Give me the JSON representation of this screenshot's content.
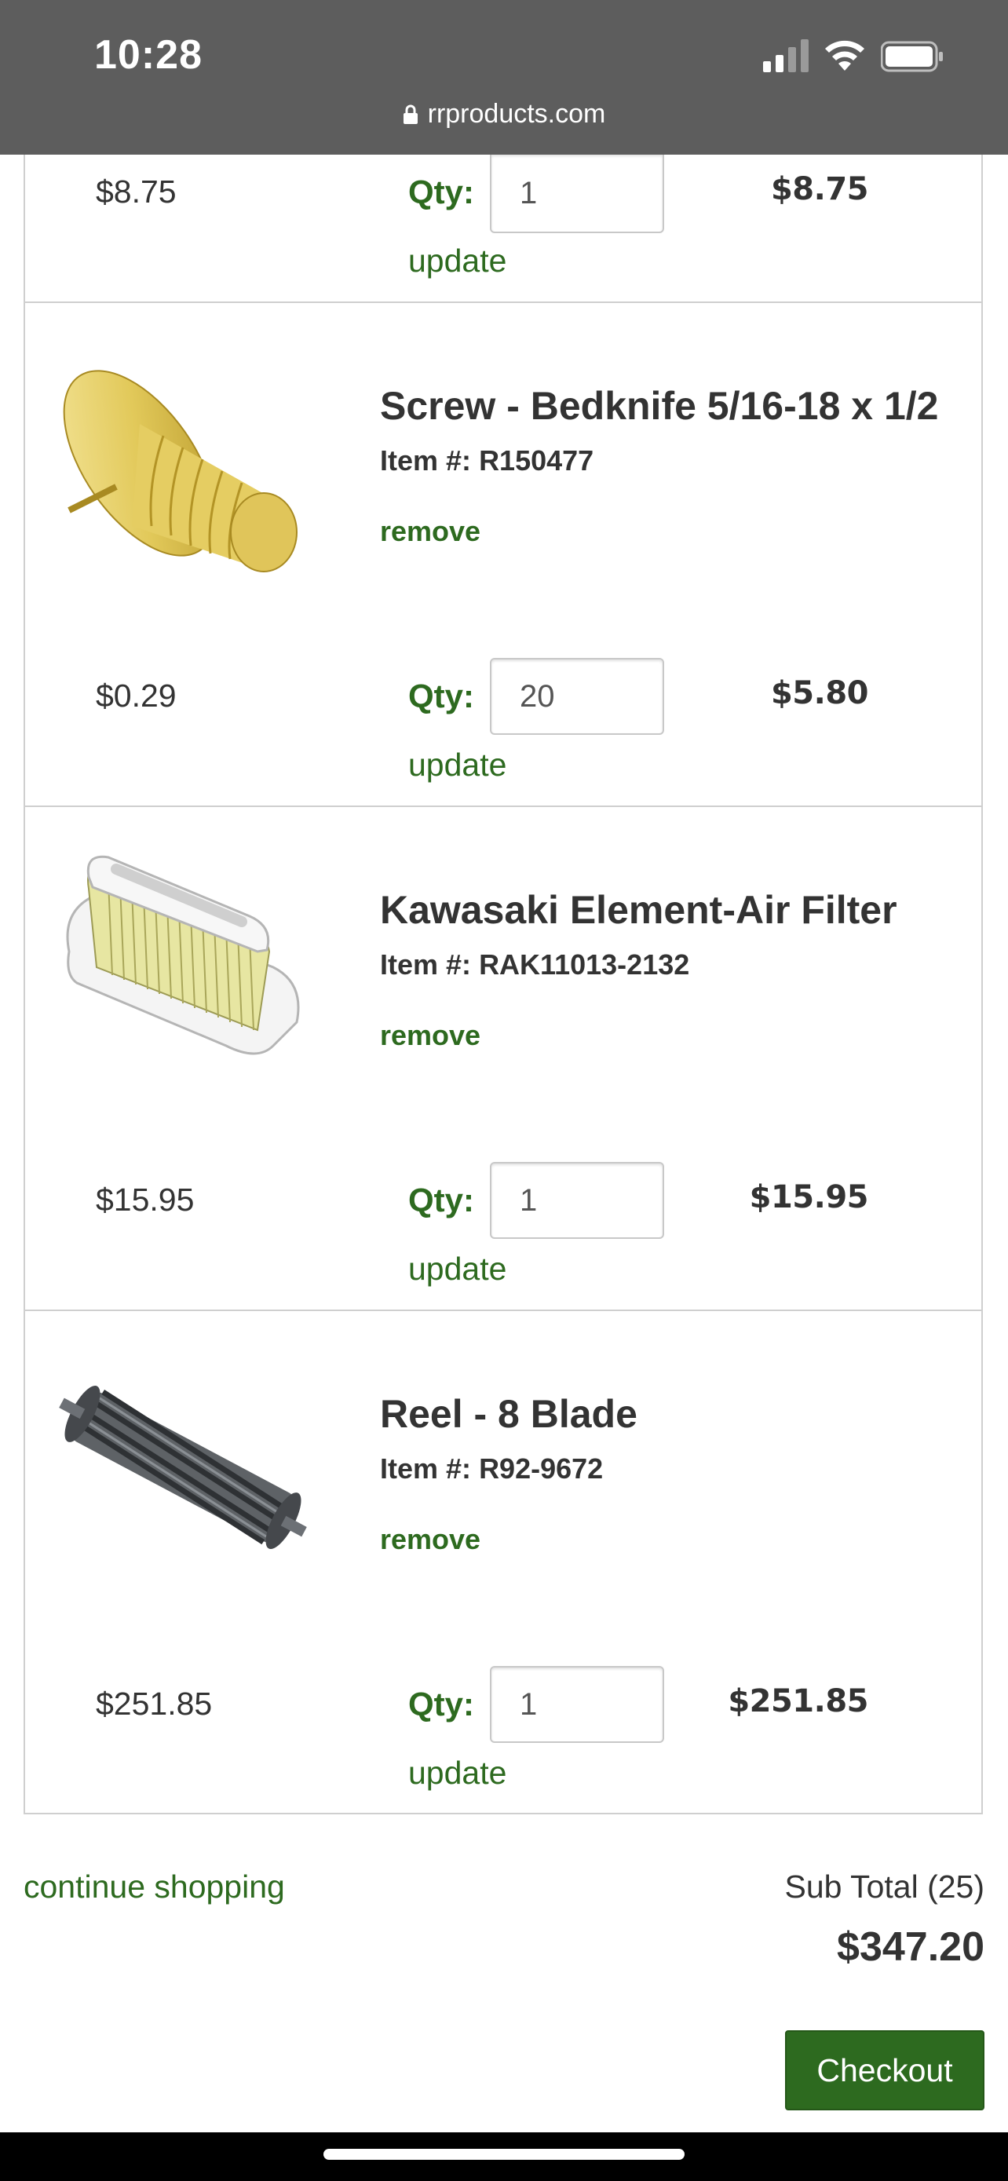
{
  "status_bar": {
    "time": "10:28",
    "url": "rrproducts.com"
  },
  "cart": {
    "qty_label": "Qty:",
    "update_label": "update",
    "remove_label": "remove",
    "item_number_prefix": "Item #:",
    "partial_item": {
      "unit_price": "$8.75",
      "quantity": "1",
      "line_total": "$8.75"
    },
    "items": [
      {
        "name": "Screw - Bedknife 5/16-18 x 1/2",
        "item_number": "R150477",
        "unit_price": "$0.29",
        "quantity": "20",
        "line_total": "$5.80",
        "image": "screw-image"
      },
      {
        "name": "Kawasaki Element-Air Filter",
        "item_number": "RAK11013-2132",
        "unit_price": "$15.95",
        "quantity": "1",
        "line_total": "$15.95",
        "image": "air-filter-image"
      },
      {
        "name": "Reel - 8 Blade",
        "item_number": "R92-9672",
        "unit_price": "$251.85",
        "quantity": "1",
        "line_total": "$251.85",
        "image": "reel-image"
      }
    ]
  },
  "footer": {
    "continue_label": "continue shopping",
    "subtotal_label": "Sub Total (25)",
    "subtotal_value": "$347.20",
    "checkout_label": "Checkout"
  },
  "colors": {
    "accent_green": "#2d6a1f",
    "status_bar": "#5d5d5d"
  }
}
